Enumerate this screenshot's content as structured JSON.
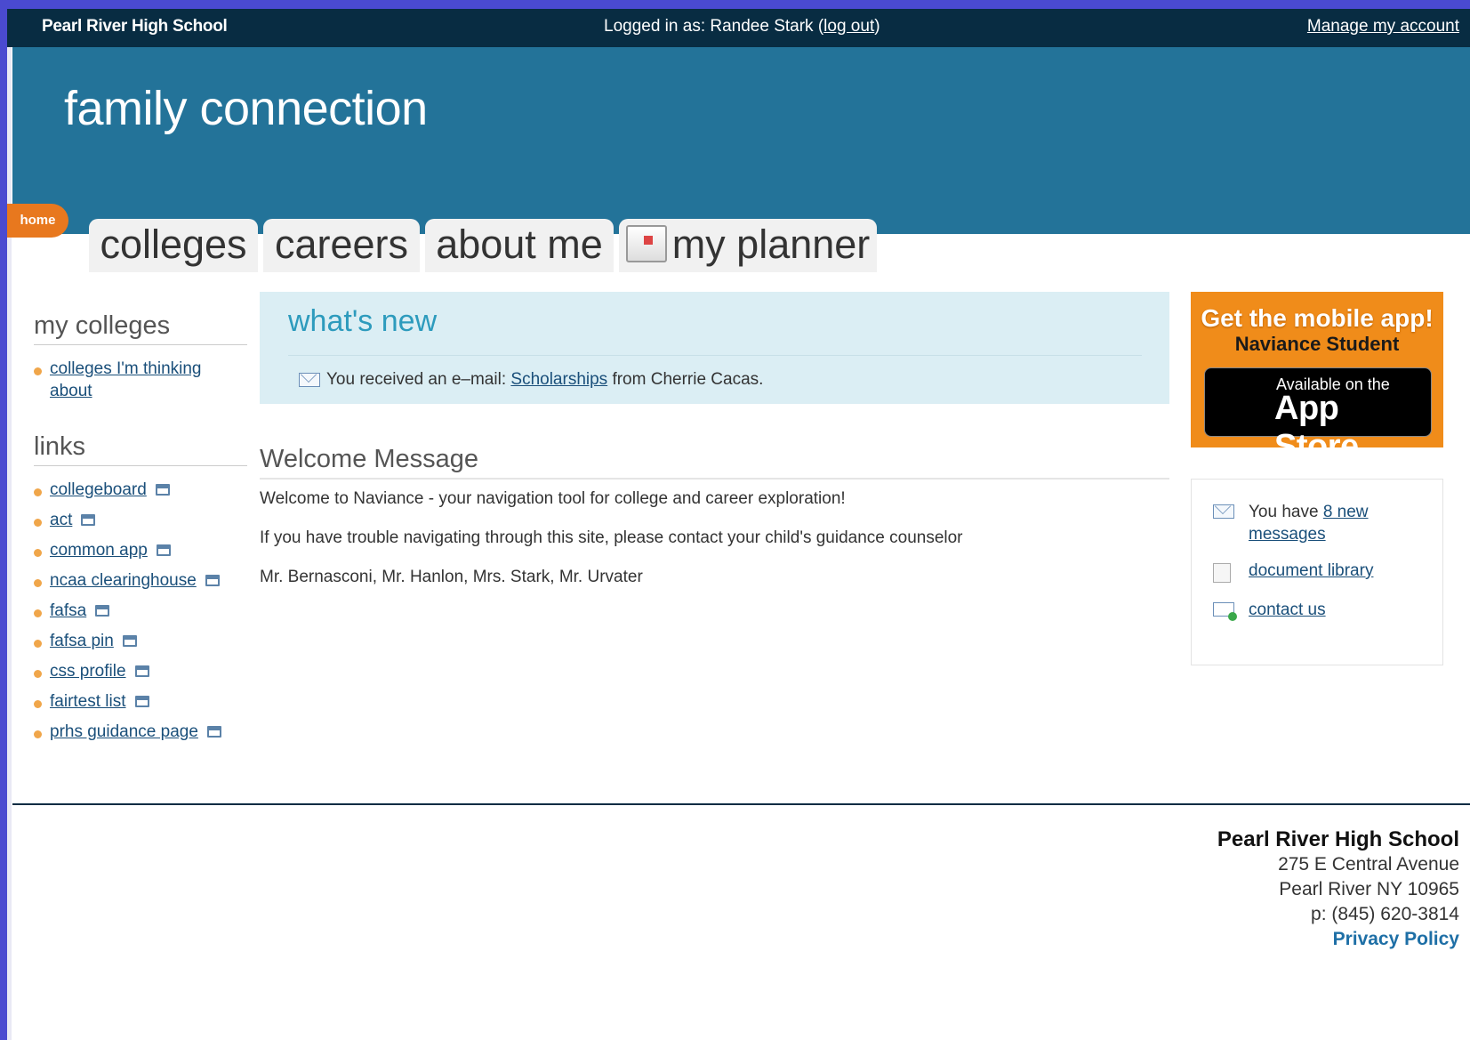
{
  "topbar": {
    "school": "Pearl River High School",
    "login_prefix": "Logged in as: Randee Stark (",
    "logout": "log out",
    "login_suffix": ")",
    "manage": "Manage my account"
  },
  "header": {
    "title": "family connection"
  },
  "nav": {
    "home": "home",
    "tabs": [
      "colleges",
      "careers",
      "about me",
      "my planner"
    ]
  },
  "my_colleges": {
    "heading": "my colleges",
    "items": [
      "colleges I'm thinking about"
    ]
  },
  "links": {
    "heading": "links",
    "items": [
      "collegeboard",
      "act",
      "common app",
      "ncaa clearinghouse",
      "fafsa",
      "fafsa pin",
      "css profile",
      "fairtest list",
      "prhs guidance page"
    ]
  },
  "whats_new": {
    "heading": "what's new",
    "msg_prefix": "You received an e–mail: ",
    "msg_link": "Scholarships",
    "msg_suffix": " from Cherrie Cacas."
  },
  "welcome": {
    "heading": "Welcome Message",
    "lines": [
      "Welcome to Naviance - your navigation tool for college and career exploration!",
      "If you have trouble navigating through this site, please contact your child's guidance counselor",
      "Mr. Bernasconi, Mr. Hanlon, Mrs. Stark, Mr. Urvater"
    ]
  },
  "promo": {
    "line1": "Get the mobile app!",
    "line2": "Naviance Student",
    "store_small": "Available on the",
    "store_big": "App Store"
  },
  "sidebox": {
    "messages_prefix": "You have ",
    "messages_link": "8 new messages",
    "document_library": "document library",
    "contact_us": "contact us"
  },
  "footer": {
    "name": "Pearl River High School",
    "address1": "275 E Central Avenue",
    "address2": "Pearl River NY 10965",
    "phone": "p: (845) 620-3814",
    "privacy": "Privacy Policy"
  },
  "colors": {
    "topbar": "#082c42",
    "header": "#237399",
    "home": "#e8781e",
    "promo": "#f08c1a"
  }
}
